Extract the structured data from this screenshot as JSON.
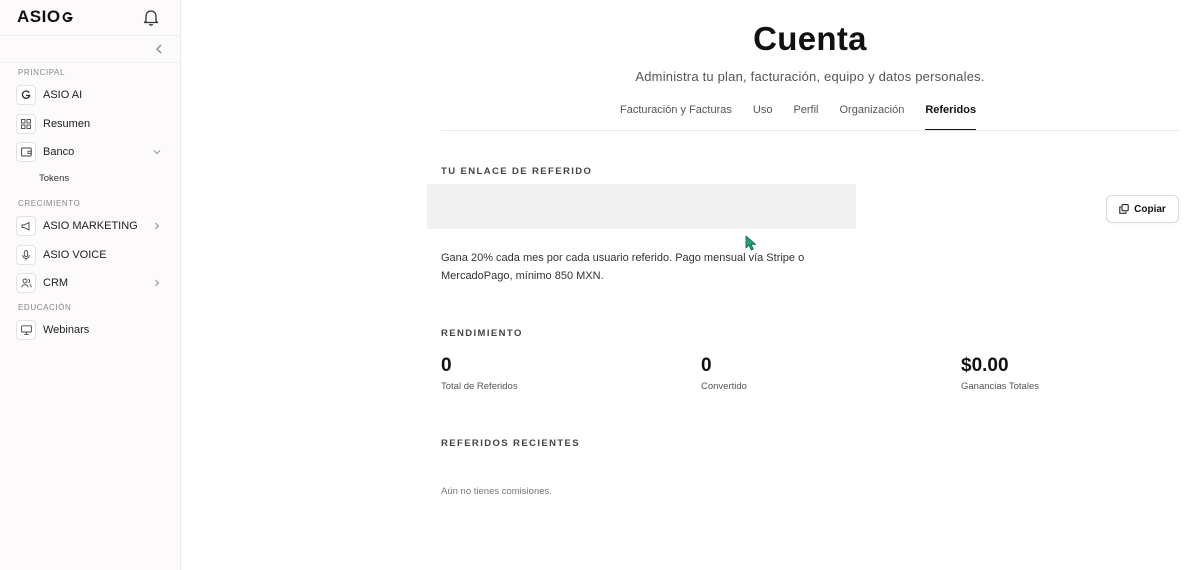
{
  "app": {
    "logo_text": "ASIO"
  },
  "sidebar": {
    "sections": [
      {
        "label": "PRINCIPAL"
      },
      {
        "label": "CRECIMIENTO"
      },
      {
        "label": "EDUCACIÓN"
      }
    ],
    "items": [
      {
        "label": "ASIO AI",
        "icon": "asio-swirl-icon"
      },
      {
        "label": "Resumen",
        "icon": "grid-icon"
      },
      {
        "label": "Banco",
        "icon": "wallet-icon",
        "expanded": true
      },
      {
        "label": "ASIO MARKETING",
        "icon": "megaphone-icon"
      },
      {
        "label": "ASIO VOICE",
        "icon": "microphone-icon"
      },
      {
        "label": "CRM",
        "icon": "users-icon"
      },
      {
        "label": "Webinars",
        "icon": "monitor-icon"
      }
    ],
    "subitems": [
      {
        "label": "Tokens"
      }
    ]
  },
  "header": {
    "title": "Cuenta",
    "subtitle": "Administra tu plan, facturación, equipo y datos personales."
  },
  "tabs": [
    {
      "label": "Facturación y Facturas",
      "active": false
    },
    {
      "label": "Uso",
      "active": false
    },
    {
      "label": "Perfil",
      "active": false
    },
    {
      "label": "Organización",
      "active": false
    },
    {
      "label": "Referidos",
      "active": true
    }
  ],
  "referral": {
    "section_label": "TU ENLACE DE REFERIDO",
    "link_value": "",
    "copy_label": "Copiar",
    "description": "Gana 20% cada mes por cada usuario referido. Pago mensual vía Stripe o MercadoPago, mínimo 850 MXN."
  },
  "performance": {
    "section_label": "RENDIMIENTO",
    "stats": [
      {
        "value": "0",
        "label": "Total de Referidos"
      },
      {
        "value": "0",
        "label": "Convertido"
      },
      {
        "value": "$0.00",
        "label": "Ganancias Totales"
      }
    ]
  },
  "recent": {
    "section_label": "REFERIDOS RECIENTES",
    "empty_text": "Aún no tienes comisiones."
  },
  "colors": {
    "cursor": "#1fa37a",
    "text": "#111111",
    "sidebar_bg": "#fcfafb"
  }
}
